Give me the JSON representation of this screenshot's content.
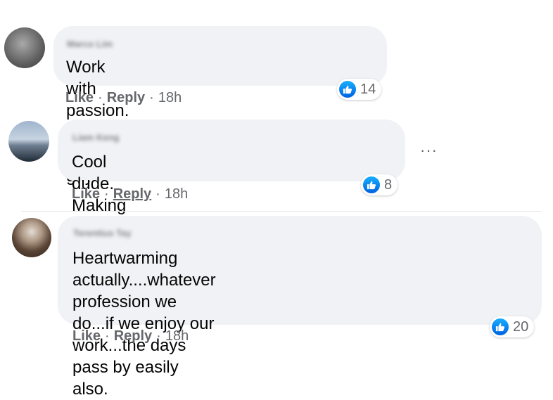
{
  "comments": [
    {
      "author": "Marco Lim",
      "text": "Work with passion. Salute to this guy",
      "like": "Like",
      "reply": "Reply",
      "time": "18h",
      "reactions": "14"
    },
    {
      "author": "Liam Keng",
      "text": "Cool dude. Making life less mundane.",
      "like": "Like",
      "reply": "Reply",
      "time": "18h",
      "reactions": "8",
      "more": "···"
    },
    {
      "author": "Terentius Tay",
      "text_lines": [
        "Heartwarming actually....whatever profession we",
        "do...if we enjoy our work...the days pass by easily",
        "also."
      ],
      "like": "Like",
      "reply": "Reply",
      "time": "18h",
      "reactions": "20"
    }
  ],
  "separator": "·",
  "colors": {
    "bubble": "#f0f2f5",
    "meta_text": "#65676b",
    "like_blue": "#1877f2"
  }
}
